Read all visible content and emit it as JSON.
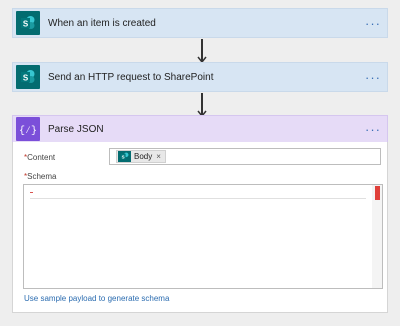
{
  "steps": [
    {
      "title": "When an item is created",
      "icon": "sharepoint-icon",
      "menu": "···"
    },
    {
      "title": "Send an HTTP request to SharePoint",
      "icon": "sharepoint-icon",
      "menu": "···"
    },
    {
      "title": "Parse JSON",
      "icon": "parse-json-icon",
      "menu": "···"
    }
  ],
  "parse_json": {
    "content_label": "Content",
    "required_mark": "*",
    "content_token": {
      "label": "Body",
      "remove": "×",
      "icon": "sharepoint-icon"
    },
    "schema_label": "Schema",
    "sample_link": "Use sample payload to generate schema"
  },
  "colors": {
    "sharepoint": "#036c70",
    "parse_json": "#7b4fd9",
    "sharepoint_header": "#d7e5f3",
    "parse_json_header": "#e6dbf7",
    "link": "#2b6cb0",
    "error": "#e0403a"
  }
}
